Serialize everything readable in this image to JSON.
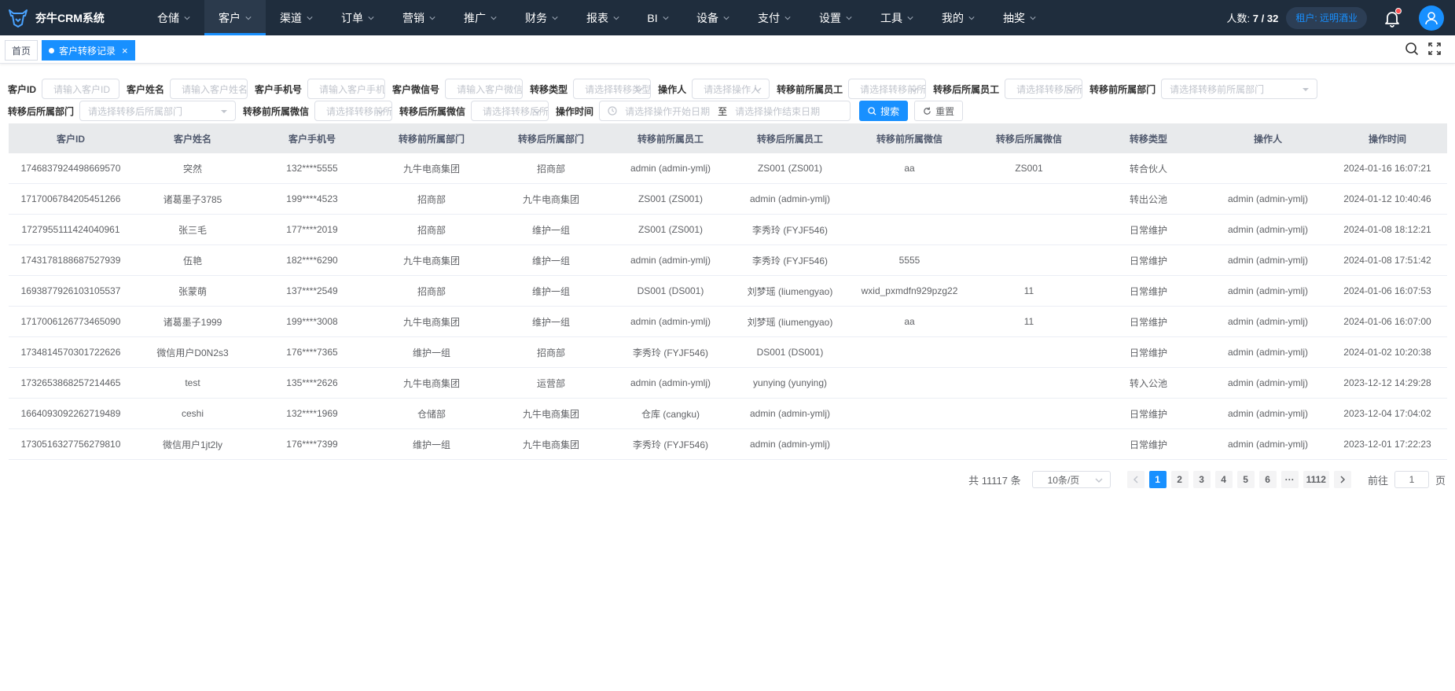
{
  "brand": {
    "title": "夯牛CRM系统"
  },
  "nav": [
    {
      "label": "仓储"
    },
    {
      "label": "客户"
    },
    {
      "label": "渠道"
    },
    {
      "label": "订单"
    },
    {
      "label": "营销"
    },
    {
      "label": "推广"
    },
    {
      "label": "财务"
    },
    {
      "label": "报表"
    },
    {
      "label": "BI"
    },
    {
      "label": "设备"
    },
    {
      "label": "支付"
    },
    {
      "label": "设置"
    },
    {
      "label": "工具"
    },
    {
      "label": "我的"
    },
    {
      "label": "抽奖"
    }
  ],
  "nav_active": "客户",
  "header": {
    "people_label": "人数:",
    "people_value": "7 / 32",
    "tenant": "租户: 远明酒业"
  },
  "tags": {
    "home": "首页",
    "active": "客户转移记录",
    "close": "×"
  },
  "filters": {
    "customer_id": {
      "label": "客户ID",
      "placeholder": "请输入客户ID"
    },
    "customer_name": {
      "label": "客户姓名",
      "placeholder": "请输入客户姓名"
    },
    "customer_phone": {
      "label": "客户手机号",
      "placeholder": "请输入客户手机号"
    },
    "customer_wechat": {
      "label": "客户微信号",
      "placeholder": "请输入客户微信号"
    },
    "transfer_type": {
      "label": "转移类型",
      "placeholder": "请选择转移类型"
    },
    "operator": {
      "label": "操作人",
      "placeholder": "请选择操作人"
    },
    "before_staff": {
      "label": "转移前所属员工",
      "placeholder": "请选择转移前所属员工"
    },
    "after_staff": {
      "label": "转移后所属员工",
      "placeholder": "请选择转移后所属员工"
    },
    "before_dept": {
      "label": "转移前所属部门",
      "placeholder": "请选择转移前所属部门"
    },
    "after_dept": {
      "label": "转移后所属部门",
      "placeholder": "请选择转移后所属部门"
    },
    "before_wechat": {
      "label": "转移前所属微信",
      "placeholder": "请选择转移前所属微信"
    },
    "after_wechat": {
      "label": "转移后所属微信",
      "placeholder": "请选择转移后所属微信"
    },
    "op_time": {
      "label": "操作时间",
      "start_placeholder": "请选择操作开始日期",
      "sep": "至",
      "end_placeholder": "请选择操作结束日期"
    },
    "search_btn": "搜索",
    "reset_btn": "重置"
  },
  "table": {
    "columns": [
      "客户ID",
      "客户姓名",
      "客户手机号",
      "转移前所属部门",
      "转移后所属部门",
      "转移前所属员工",
      "转移后所属员工",
      "转移前所属微信",
      "转移后所属微信",
      "转移类型",
      "操作人",
      "操作时间"
    ],
    "rows": [
      [
        "1746837924498669570",
        "突然",
        "132****5555",
        "九牛电商集团",
        "招商部",
        "admin (admin-ymlj)",
        "ZS001 (ZS001)",
        "aa",
        "ZS001",
        "转合伙人",
        "",
        "2024-01-16 16:07:21"
      ],
      [
        "1717006784205451266",
        "诸葛墨子3785",
        "199****4523",
        "招商部",
        "九牛电商集团",
        "ZS001 (ZS001)",
        "admin (admin-ymlj)",
        "",
        "",
        "转出公池",
        "admin (admin-ymlj)",
        "2024-01-12 10:40:46"
      ],
      [
        "1727955111424040961",
        "张三毛",
        "177****2019",
        "招商部",
        "维护一组",
        "ZS001 (ZS001)",
        "李秀玲 (FYJF546)",
        "",
        "",
        "日常维护",
        "admin (admin-ymlj)",
        "2024-01-08 18:12:21"
      ],
      [
        "1743178188687527939",
        "伍艳",
        "182****6290",
        "九牛电商集团",
        "维护一组",
        "admin (admin-ymlj)",
        "李秀玲 (FYJF546)",
        "5555",
        "",
        "日常维护",
        "admin (admin-ymlj)",
        "2024-01-08 17:51:42"
      ],
      [
        "1693877926103105537",
        "张蒙萌",
        "137****2549",
        "招商部",
        "维护一组",
        "DS001 (DS001)",
        "刘梦瑶 (liumengyao)",
        "wxid_pxmdfn929pzg22",
        "11",
        "日常维护",
        "admin (admin-ymlj)",
        "2024-01-06 16:07:53"
      ],
      [
        "1717006126773465090",
        "诸葛墨子1999",
        "199****3008",
        "九牛电商集团",
        "维护一组",
        "admin (admin-ymlj)",
        "刘梦瑶 (liumengyao)",
        "aa",
        "11",
        "日常维护",
        "admin (admin-ymlj)",
        "2024-01-06 16:07:00"
      ],
      [
        "1734814570301722626",
        "微信用户D0N2s3",
        "176****7365",
        "维护一组",
        "招商部",
        "李秀玲 (FYJF546)",
        "DS001 (DS001)",
        "",
        "",
        "日常维护",
        "admin (admin-ymlj)",
        "2024-01-02 10:20:38"
      ],
      [
        "1732653868257214465",
        "test",
        "135****2626",
        "九牛电商集团",
        "运营部",
        "admin (admin-ymlj)",
        "yunying (yunying)",
        "",
        "",
        "转入公池",
        "admin (admin-ymlj)",
        "2023-12-12 14:29:28"
      ],
      [
        "1664093092262719489",
        "ceshi",
        "132****1969",
        "仓储部",
        "九牛电商集团",
        "仓库 (cangku)",
        "admin (admin-ymlj)",
        "",
        "",
        "日常维护",
        "admin (admin-ymlj)",
        "2023-12-04 17:04:02"
      ],
      [
        "1730516327756279810",
        "微信用户1jt2ly",
        "176****7399",
        "维护一组",
        "九牛电商集团",
        "李秀玲 (FYJF546)",
        "admin (admin-ymlj)",
        "",
        "",
        "日常维护",
        "admin (admin-ymlj)",
        "2023-12-01 17:22:23"
      ]
    ]
  },
  "pagination": {
    "total": "共 11117 条",
    "page_size": "10条/页",
    "pages": [
      "1",
      "2",
      "3",
      "4",
      "5",
      "6",
      "···",
      "1112"
    ],
    "current": "1",
    "goto_label": "前往",
    "goto_value": "1",
    "goto_suffix": "页"
  },
  "colors": {
    "topbar": "#1f2d3d",
    "accent": "#1890ff",
    "table_header": "#e8eaec"
  }
}
